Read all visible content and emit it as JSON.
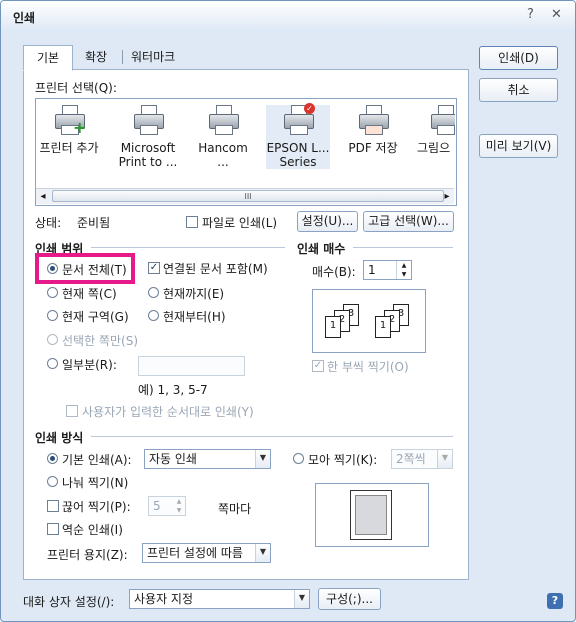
{
  "window": {
    "title": "인쇄",
    "help": "?",
    "close": "✕"
  },
  "tabs": [
    "기본",
    "확장",
    "워터마크"
  ],
  "printer_select": {
    "label": "프린터 선택(Q):",
    "printers": [
      {
        "line1": "프린터 추가",
        "line2": ""
      },
      {
        "line1": "Microsoft",
        "line2": "Print to ..."
      },
      {
        "line1": "Hancom ...",
        "line2": ""
      },
      {
        "line1": "EPSON L...",
        "line2": "Series"
      },
      {
        "line1": "PDF 저장",
        "line2": ""
      },
      {
        "line1": "그림으",
        "line2": ""
      }
    ],
    "scroll_left": "◂",
    "scroll_right": "▸",
    "scroll_thumb": "III"
  },
  "status": {
    "label": "상태:",
    "value": "준비됨"
  },
  "print_to_file": "파일로 인쇄(L)",
  "settings_button": "설정(U)...",
  "advanced_button": "고급 선택(W)...",
  "range": {
    "title": "인쇄 범위",
    "whole_doc": "문서 전체(T)",
    "include_linked": "연결된 문서 포함(M)",
    "current_page": "현재 쪽(C)",
    "until_current": "현재까지(E)",
    "current_section": "현재 구역(G)",
    "from_current": "현재부터(H)",
    "selection_only": "선택한 쪽만(S)",
    "partial": "일부분(R):",
    "example": "예) 1, 3, 5-7",
    "user_order": "사용자가 입력한 순서대로 인쇄(Y)"
  },
  "copies": {
    "title": "인쇄 매수",
    "label": "매수(B):",
    "value": "1",
    "collate": "한 부씩 찍기(O)",
    "collate_icon_digits": [
      "1",
      "2",
      "3",
      "1",
      "2",
      "3"
    ]
  },
  "method": {
    "title": "인쇄 방식",
    "default_print": "기본 인쇄(A):",
    "default_value": "자동 인쇄",
    "split_print": "나눠 찍기(N)",
    "cut_print": "끊어 찍기(P):",
    "cut_value": "5",
    "per_page": "쪽마다",
    "reverse_print": "역순 인쇄(I)",
    "paper_label": "프린터 용지(Z):",
    "paper_value": "프린터 설정에 따름",
    "gather_print": "모아 찍기(K):",
    "gather_value": "2쪽씩"
  },
  "side_buttons": {
    "print": "인쇄(D)",
    "cancel": "취소",
    "preview": "미리 보기(V)"
  },
  "footer": {
    "dialog_setting_label": "대화 상자 설정(/):",
    "dialog_setting_value": "사용자 지정",
    "configure_button": "구성(;)...",
    "help_icon": "?"
  },
  "colors": {
    "highlight": "#e6198a",
    "accent": "#2a4f7a"
  }
}
